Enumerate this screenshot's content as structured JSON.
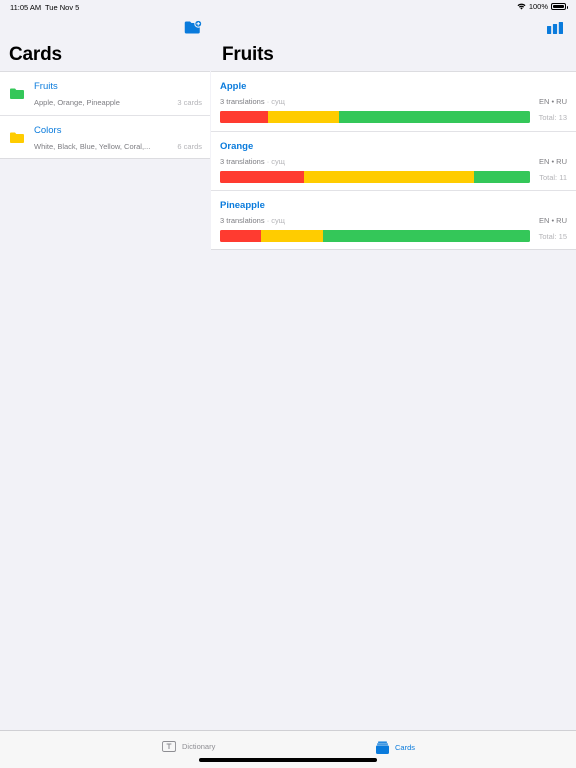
{
  "status_bar": {
    "time": "11:05 AM",
    "date": "Tue Nov 5",
    "battery": "100%"
  },
  "sidebar": {
    "title": "Cards",
    "decks": [
      {
        "name": "Fruits",
        "words": "Apple, Orange, Pineapple",
        "count": "3 cards",
        "color": "#34c759"
      },
      {
        "name": "Colors",
        "words": "White, Black, Blue, Yellow, Coral,...",
        "count": "6 cards",
        "color": "#ffcc00"
      }
    ]
  },
  "main": {
    "title": "Fruits",
    "cards": [
      {
        "word": "Apple",
        "translations": "3 translations",
        "pos": "сущ",
        "langs": "EN • RU",
        "total": "Total: 13",
        "progress": [
          0.155,
          0.23,
          0.615
        ]
      },
      {
        "word": "Orange",
        "translations": "3 translations",
        "pos": "сущ",
        "langs": "EN • RU",
        "total": "Total: 11",
        "progress": [
          0.272,
          0.548,
          0.18
        ]
      },
      {
        "word": "Pineapple",
        "translations": "3 translations",
        "pos": "сущ",
        "langs": "EN • RU",
        "total": "Total: 15",
        "progress": [
          0.133,
          0.2,
          0.667
        ]
      }
    ],
    "progress_colors": [
      "#ff3b30",
      "#ffcc00",
      "#34c759"
    ]
  },
  "tab_bar": {
    "items": [
      {
        "label": "Dictionary",
        "selected": false
      },
      {
        "label": "Cards",
        "selected": true
      }
    ]
  },
  "colors": {
    "accent": "#0a7bdc"
  }
}
